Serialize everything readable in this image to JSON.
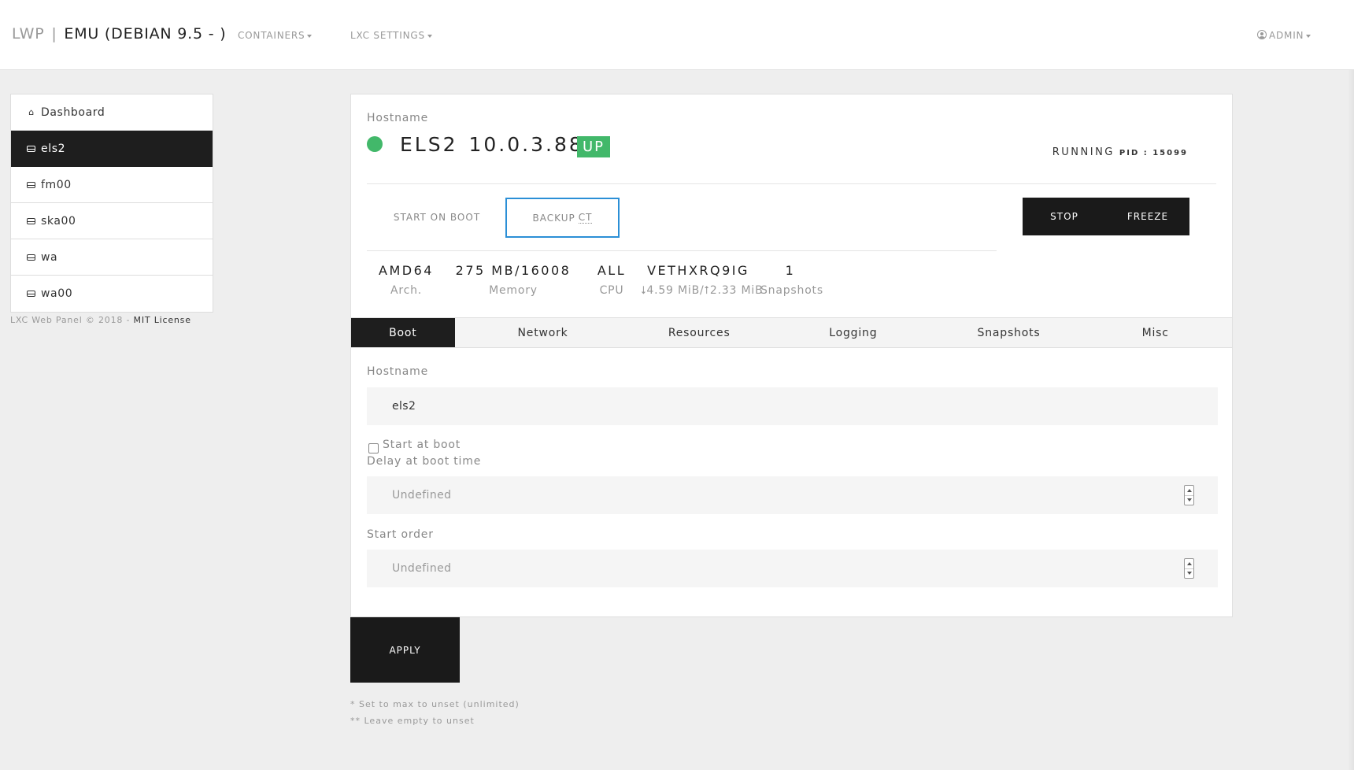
{
  "brand": {
    "lwp": "LWP",
    "separator": "|",
    "host": "EMU (DEBIAN 9.5 - )"
  },
  "topnav": {
    "containers": "CONTAINERS",
    "lxc_settings": "LXC SETTINGS",
    "admin": "ADMIN"
  },
  "sidebar": {
    "items": [
      {
        "label": "Dashboard"
      },
      {
        "label": "els2"
      },
      {
        "label": "fm00"
      },
      {
        "label": "ska00"
      },
      {
        "label": "wa"
      },
      {
        "label": "wa00"
      }
    ]
  },
  "footer": {
    "credit": "LXC Web Panel © 2018 - ",
    "license": "MIT License"
  },
  "container": {
    "hostname_label": "Hostname",
    "name": "ELS2",
    "ip": "10.0.3.88",
    "state_badge": "UP",
    "status": "RUNNING",
    "pid": "PID : 15099",
    "status_color": "#42b86a"
  },
  "actions": {
    "start_on_boot": "START ON BOOT",
    "backup": "BACKUP",
    "backup_ct": "CT",
    "stop": "STOP",
    "freeze": "FREEZE"
  },
  "stats": {
    "arch_value": "AMD64",
    "arch_label": "Arch.",
    "memory_value": "275 MB/16008",
    "memory_label": "Memory",
    "cpu_value": "ALL",
    "cpu_label": "CPU",
    "net_value": "VETHXRQ9IG",
    "net_label": "⭣4.59 MiB/⭡2.33 MiB",
    "snapshots_value": "1",
    "snapshots_label": "Snapshots"
  },
  "tabs": [
    {
      "label": "Boot"
    },
    {
      "label": "Network"
    },
    {
      "label": "Resources"
    },
    {
      "label": "Logging"
    },
    {
      "label": "Snapshots"
    },
    {
      "label": "Misc"
    }
  ],
  "form": {
    "hostname_label": "Hostname",
    "hostname_value": "els2",
    "start_at_boot_label": "Start at boot",
    "delay_label": "Delay at boot time",
    "delay_placeholder": "Undefined",
    "start_order_label": "Start order",
    "start_order_placeholder": "Undefined",
    "apply": "APPLY"
  },
  "notes": {
    "note1": "* Set to max to unset (unlimited)",
    "note2": "** Leave empty to unset"
  }
}
